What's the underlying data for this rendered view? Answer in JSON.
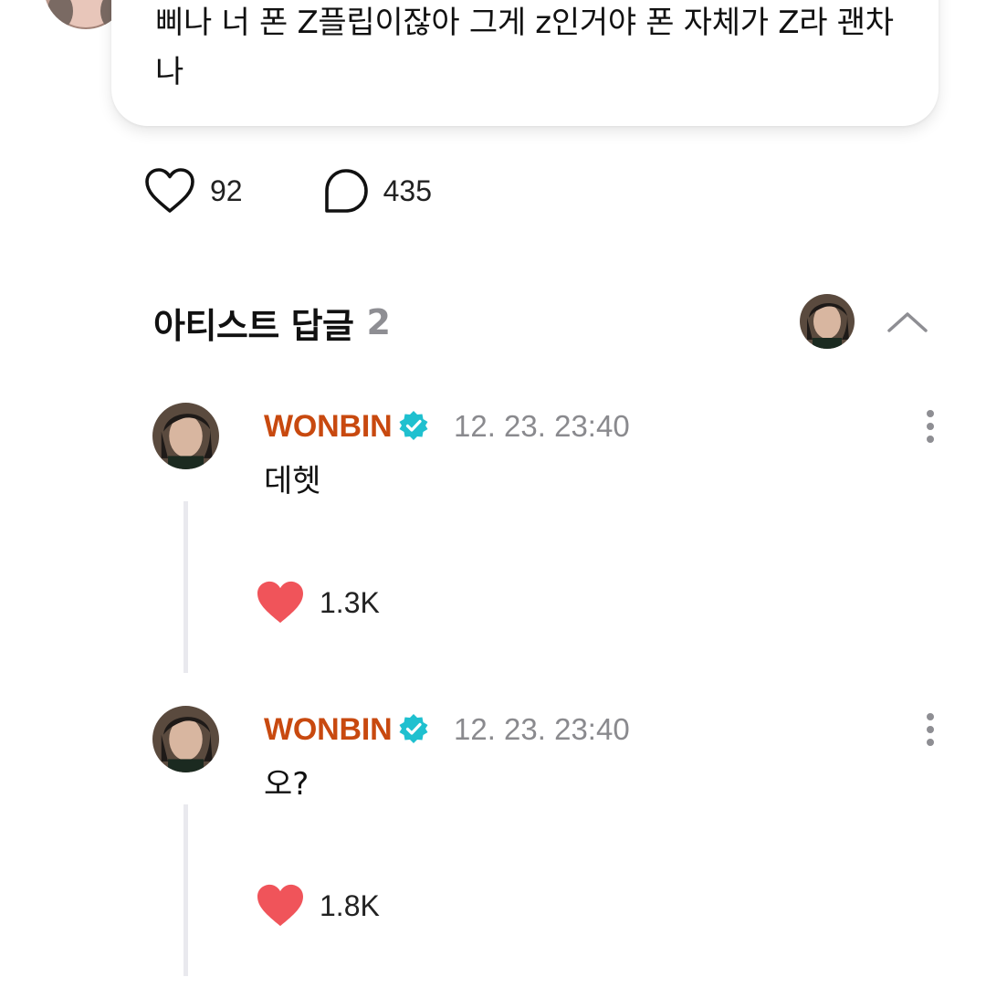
{
  "post": {
    "text": "삐나 너 폰 Z플립이잖아 그게 z인거야 폰 자체가 Z라 괜차나",
    "likes": "92",
    "comments": "435"
  },
  "artist_replies": {
    "title": "아티스트 답글",
    "count": "2"
  },
  "replies": [
    {
      "author": "WONBIN",
      "timestamp": "12. 23. 23:40",
      "text": "데헷",
      "likes": "1.3K"
    },
    {
      "author": "WONBIN",
      "timestamp": "12. 23. 23:40",
      "text": "오?",
      "likes": "1.8K"
    }
  ],
  "colors": {
    "author_name": "#c8490f",
    "verified_badge": "#1fc0cf",
    "liked_heart": "#f0545a",
    "muted_text": "#8a8a8e"
  },
  "icons": {
    "like_outline": "heart-outline-icon",
    "comment": "speech-bubble-icon",
    "collapse": "chevron-up-icon",
    "verified": "verified-check-badge-icon",
    "more": "more-vertical-icon",
    "liked": "heart-filled-icon"
  }
}
